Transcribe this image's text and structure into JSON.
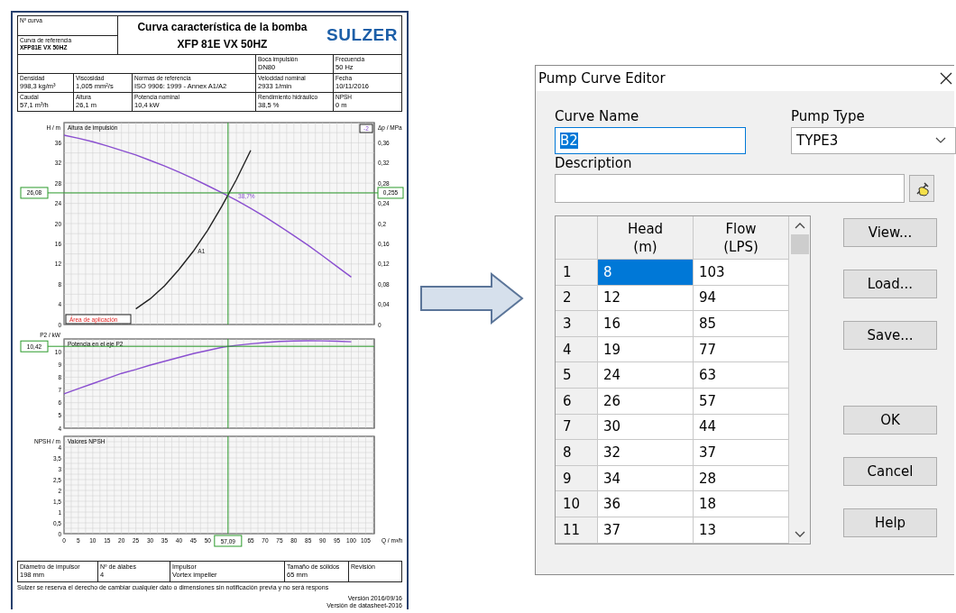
{
  "datasheet": {
    "curve_no_label": "Nº curva",
    "ref_label": "Curva de referencia",
    "ref_value": "XFP81E VX 50HZ",
    "title": "Curva característica de la bomba",
    "subtitle": "XFP 81E VX 50HZ",
    "logo": "SULZER",
    "info_rows": [
      [
        {
          "label": "Boca impulsión",
          "value": "DN80"
        },
        {
          "label": "Frecuencia",
          "value": "50  Hz"
        }
      ],
      [
        {
          "label": "Densidad",
          "value": "998,3 kg/m³"
        },
        {
          "label": "Viscosidad",
          "value": "1,005 mm²/s"
        },
        {
          "label": "Normas de referencia",
          "value": "ISO 9906: 1999 - Annex A1/A2"
        },
        {
          "label": "Velocidad nominal",
          "value": "2933 1/min"
        },
        {
          "label": "Fecha",
          "value": "10/11/2016"
        }
      ],
      [
        {
          "label": "Caudal",
          "value": "57,1 m³/h"
        },
        {
          "label": "Altura",
          "value": "26,1 m"
        },
        {
          "label": "Potencia nominal",
          "value": "10,4 kW"
        },
        {
          "label": "Rendimiento hidráulico",
          "value": "38,5 %"
        },
        {
          "label": "NPSH",
          "value": "0 m"
        }
      ]
    ],
    "charts": [
      {
        "chart_data": {
          "type": "line",
          "title": "Altura de impulsión",
          "ylabel": "H / m",
          "grid": true,
          "xlim": [
            0,
            108
          ],
          "ylim": [
            0,
            40
          ],
          "yticks": [
            0,
            4,
            8,
            12,
            16,
            20,
            24,
            28,
            32,
            36
          ],
          "x": [
            0,
            5,
            10,
            15,
            20,
            25,
            30,
            35,
            40,
            45,
            50,
            55,
            60,
            65,
            70,
            75,
            80,
            85,
            90,
            95,
            100
          ],
          "series": [
            {
              "color": "#8a4fd0",
              "values": [
                37.5,
                36.9,
                36.2,
                35.4,
                34.5,
                33.6,
                32.5,
                31.4,
                30.2,
                28.9,
                27.5,
                26.1,
                24.6,
                23.0,
                21.3,
                19.5,
                17.6,
                15.7,
                13.6,
                11.5,
                9.4
              ]
            },
            {
              "name": "A1",
              "color": "#222222",
              "values": [
                null,
                null,
                null,
                null,
                null,
                3.1,
                5.1,
                7.7,
                10.9,
                14.5,
                18.7,
                23.5,
                28.7,
                34.5,
                null,
                null,
                null,
                null,
                null,
                null,
                null
              ]
            }
          ],
          "annotations": [
            {
              "text": "38,7%",
              "x": 60,
              "y": 24.6
            }
          ],
          "ref_lines": [
            {
              "axis": "x",
              "value": 57.09
            },
            {
              "axis": "y",
              "value": 26.08,
              "label": "26,08"
            }
          ]
        },
        "y2label": "Δp / MPa",
        "y2tick_labels": [
          "0,36",
          "0,32",
          "0,28",
          "0,24",
          "0,2",
          "0,16",
          "0,12",
          "0,08",
          "0,04",
          "0"
        ],
        "y2_readout": "0,255",
        "range_box": "Área de aplicación",
        "corner_box": "-2"
      },
      {
        "chart_data": {
          "type": "line",
          "title": "Potencia en el eje P2",
          "ylabel": "P2 / kW",
          "grid": true,
          "xlim": [
            0,
            108
          ],
          "ylim": [
            4,
            11
          ],
          "yticks": [
            4,
            5,
            6,
            7,
            8,
            9,
            10
          ],
          "x": [
            0,
            5,
            10,
            15,
            20,
            25,
            30,
            35,
            40,
            45,
            50,
            55,
            60,
            65,
            70,
            75,
            80,
            85,
            90,
            95,
            100
          ],
          "series": [
            {
              "color": "#8a4fd0",
              "values": [
                6.7,
                7.1,
                7.5,
                7.9,
                8.3,
                8.6,
                8.95,
                9.25,
                9.55,
                9.85,
                10.1,
                10.35,
                10.5,
                10.62,
                10.72,
                10.8,
                10.84,
                10.86,
                10.85,
                10.82,
                10.78
              ]
            }
          ],
          "ref_lines": [
            {
              "axis": "x",
              "value": 57.09
            },
            {
              "axis": "y",
              "value": 10.42,
              "label": "10,42"
            }
          ]
        }
      },
      {
        "chart_data": {
          "type": "line",
          "title": "Valores NPSH",
          "ylabel": "NPSH  / m",
          "xlabel": "Q / m³/h",
          "grid": true,
          "xlim": [
            0,
            108
          ],
          "ylim": [
            0,
            4.5
          ],
          "xticks": [
            0,
            5,
            10,
            15,
            20,
            25,
            30,
            35,
            40,
            45,
            50,
            65,
            70,
            75,
            80,
            85,
            90,
            95,
            100,
            105
          ],
          "yticks": [
            0,
            {
              "value": 0.5,
              "label": "0,5"
            },
            1,
            {
              "value": 1.5,
              "label": "1,5"
            },
            2,
            {
              "value": 2.5,
              "label": "2,5"
            },
            3,
            {
              "value": 3.5,
              "label": "3,5"
            },
            4
          ],
          "ref_lines": [
            {
              "axis": "x",
              "value": 57.09,
              "label": "57,09"
            }
          ]
        }
      }
    ],
    "footer_cells": [
      {
        "label": "Diámetro de impulsor",
        "value": "198 mm"
      },
      {
        "label": "Nº de álabes",
        "value": "4"
      },
      {
        "label": "Impulsor",
        "value": "Vortex impeller"
      },
      {
        "label": "Tamaño de sólidos",
        "value": "65 mm"
      },
      {
        "label": "Revisión"
      }
    ],
    "disclaimer": "Sulzer se reserva el derecho de cambiar cualquier dato o dimensiones sin notificación previa y no será respons",
    "version_lines": [
      "Versión 2016/09/16",
      "Versión de datasheet-2016"
    ]
  },
  "dialog": {
    "title": "Pump Curve Editor",
    "curve_name": {
      "label": "Curve Name",
      "value": "B2",
      "selected": true
    },
    "pump_type": {
      "label": "Pump Type",
      "value": "TYPE3"
    },
    "description": {
      "label": "Description"
    },
    "table": {
      "columns": [
        {
          "name": "Head",
          "unit": "(m)"
        },
        {
          "name": "Flow",
          "unit": "(LPS)"
        }
      ],
      "rows": [
        {
          "index": "1",
          "head": "8",
          "flow": "103",
          "selected": true
        },
        {
          "index": "2",
          "head": "12",
          "flow": "94",
          "selected": false
        },
        {
          "index": "3",
          "head": "16",
          "flow": "85",
          "selected": false
        },
        {
          "index": "4",
          "head": "19",
          "flow": "77",
          "selected": false
        },
        {
          "index": "5",
          "head": "24",
          "flow": "63",
          "selected": false
        },
        {
          "index": "6",
          "head": "26",
          "flow": "57",
          "selected": false
        },
        {
          "index": "7",
          "head": "30",
          "flow": "44",
          "selected": false
        },
        {
          "index": "8",
          "head": "32",
          "flow": "37",
          "selected": false
        },
        {
          "index": "9",
          "head": "34",
          "flow": "28",
          "selected": false
        },
        {
          "index": "10",
          "head": "36",
          "flow": "18",
          "selected": false
        },
        {
          "index": "11",
          "head": "37",
          "flow": "13",
          "selected": false
        }
      ]
    },
    "file_buttons": [
      "View...",
      "Load...",
      "Save..."
    ],
    "dialog_buttons": [
      "OK",
      "Cancel",
      "Help"
    ]
  }
}
